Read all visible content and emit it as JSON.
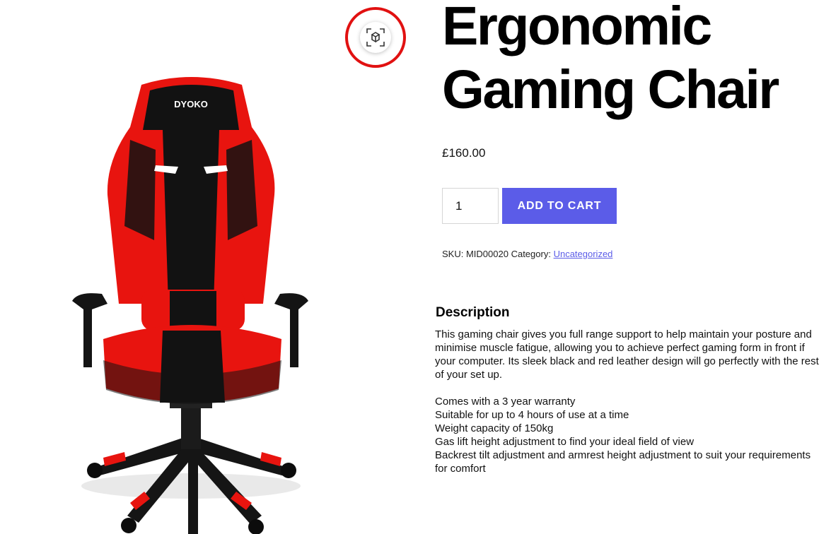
{
  "gallery": {
    "image_alt": "Ergonomic Gaming Chair",
    "chair_logo": "DYOKO",
    "ar_button_icon": "view-in-3d-icon"
  },
  "product": {
    "title": "Ergonomic\nGaming Chair",
    "price": "£160.00",
    "quantity": "1",
    "add_to_cart_label": "ADD TO CART",
    "sku_label": "SKU:",
    "sku": "MID00020",
    "category_label": "Category:",
    "category": "Uncategorized"
  },
  "description": {
    "heading": "Description",
    "body": "This gaming chair gives you full range support to help maintain your posture and minimise muscle fatigue, allowing you to achieve perfect gaming form in front if your computer. Its sleek black and red leather design will go perfectly with the rest of your set up.",
    "features": [
      "Comes with a 3 year warranty",
      "Suitable for up to 4 hours of use at a time",
      "Weight capacity of 150kg",
      "Gas lift height adjustment to find your ideal field of view",
      "Backrest tilt adjustment and armrest height adjustment to suit your requirements for comfort"
    ]
  },
  "colors": {
    "accent": "#5b5ce8",
    "highlight_ring": "#e11111",
    "chair_red": "#e8140f",
    "chair_black": "#121212"
  }
}
